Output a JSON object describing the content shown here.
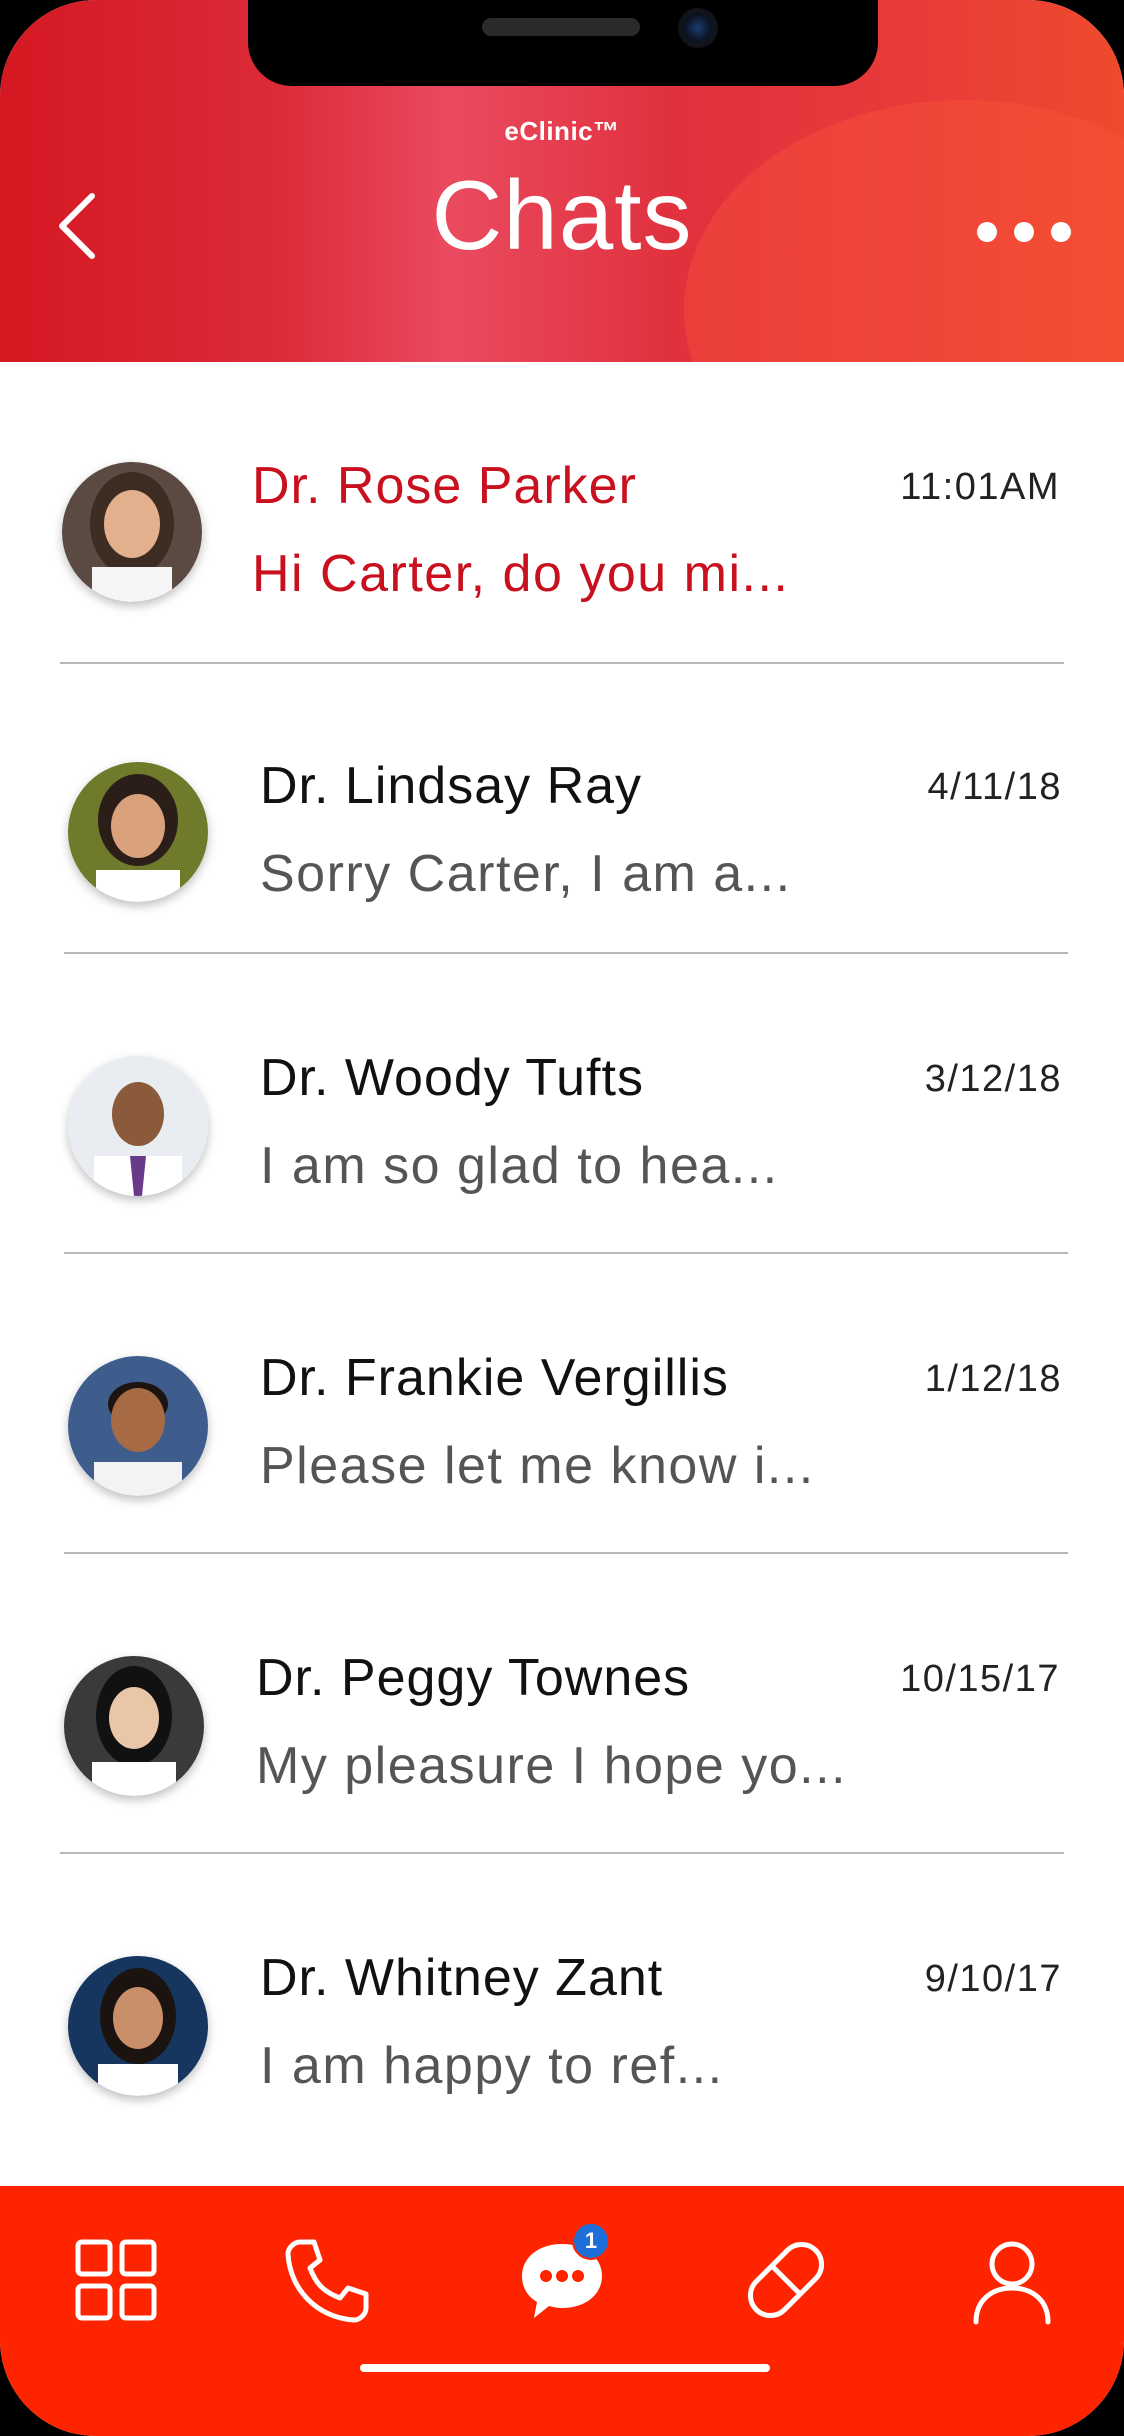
{
  "header": {
    "brand": "eClinic™",
    "title": "Chats"
  },
  "chats": [
    {
      "name": "Dr. Rose Parker",
      "preview": "Hi Carter, do you mi...",
      "time": "11:01AM",
      "active": true
    },
    {
      "name": "Dr. Lindsay Ray",
      "preview": "Sorry Carter, I am a...",
      "time": "4/11/18",
      "active": false
    },
    {
      "name": "Dr. Woody Tufts",
      "preview": "I am so glad to hea...",
      "time": "3/12/18",
      "active": false
    },
    {
      "name": "Dr. Frankie Vergillis",
      "preview": "Please let me know i...",
      "time": "1/12/18",
      "active": false
    },
    {
      "name": "Dr. Peggy Townes",
      "preview": "My pleasure I hope yo...",
      "time": "10/15/17",
      "active": false
    },
    {
      "name": "Dr. Whitney Zant",
      "preview": "I am happy to ref...",
      "time": "9/10/17",
      "active": false
    }
  ],
  "tabbar": {
    "items": [
      {
        "icon": "grid-icon",
        "label": "dashboard"
      },
      {
        "icon": "phone-icon",
        "label": "calls"
      },
      {
        "icon": "chat-bubble-icon",
        "label": "chats",
        "badge": "1"
      },
      {
        "icon": "pill-icon",
        "label": "medications"
      },
      {
        "icon": "profile-icon",
        "label": "profile"
      }
    ]
  },
  "colors": {
    "header_red": "#d41822",
    "accent_red": "#c8101e",
    "tabbar_red": "#ff2400",
    "badge_blue": "#1e6fd9"
  }
}
